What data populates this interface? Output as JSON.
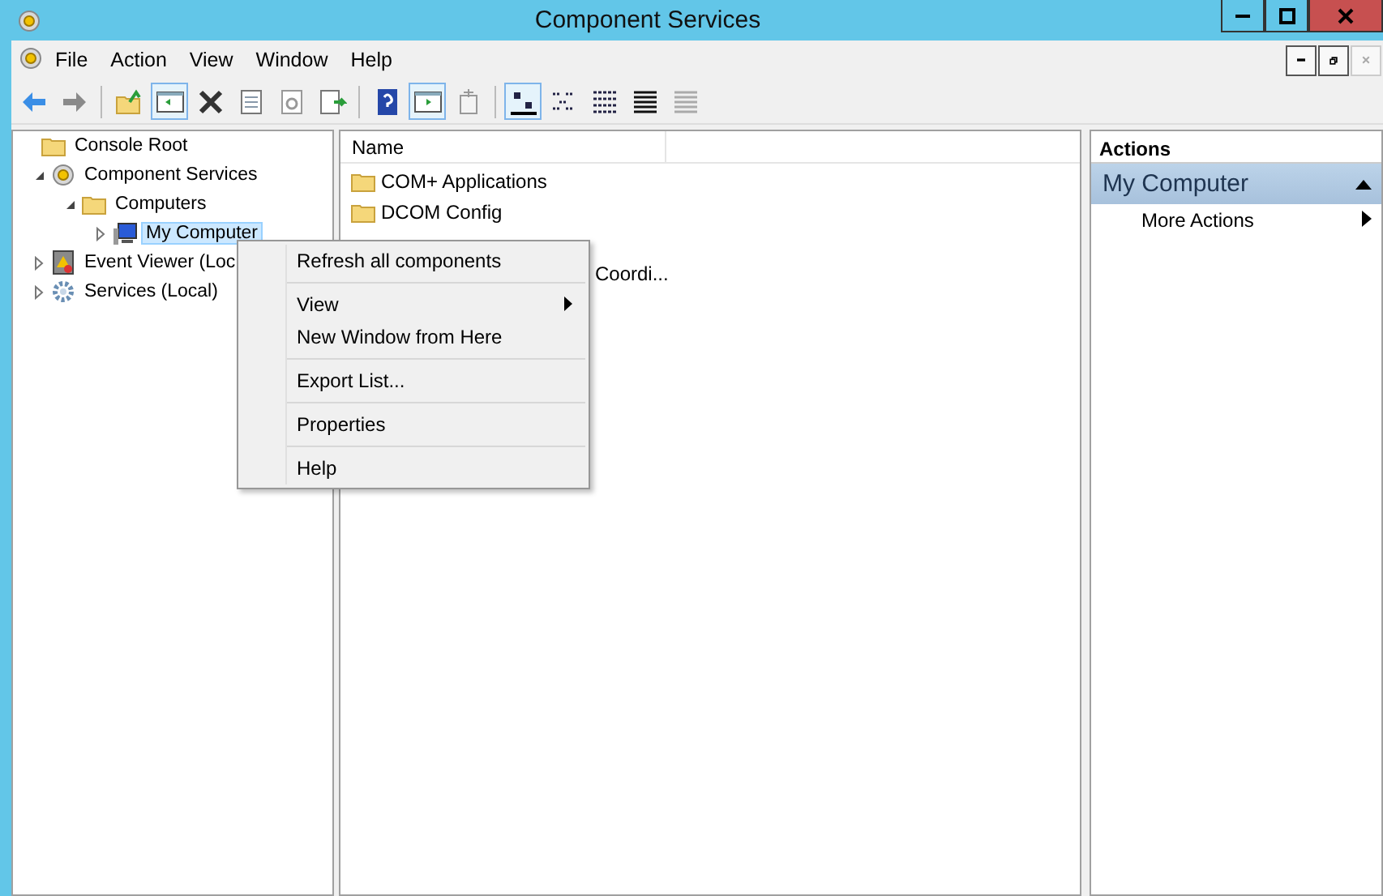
{
  "window": {
    "title": "Component Services"
  },
  "menu_bar": [
    "File",
    "Action",
    "View",
    "Window",
    "Help"
  ],
  "toolbar": [
    {
      "kind": "back",
      "pressed": false
    },
    {
      "kind": "forward",
      "pressed": false
    },
    {
      "kind": "sep"
    },
    {
      "kind": "up",
      "pressed": false
    },
    {
      "kind": "tree",
      "pressed": true
    },
    {
      "kind": "delete",
      "pressed": false
    },
    {
      "kind": "props",
      "pressed": false
    },
    {
      "kind": "refresh",
      "pressed": false
    },
    {
      "kind": "export",
      "pressed": false
    },
    {
      "kind": "sep"
    },
    {
      "kind": "help",
      "pressed": false
    },
    {
      "kind": "actionpane",
      "pressed": true
    },
    {
      "kind": "newwin",
      "pressed": false
    },
    {
      "kind": "sep"
    },
    {
      "kind": "large",
      "pressed": true
    },
    {
      "kind": "small",
      "pressed": false
    },
    {
      "kind": "list",
      "pressed": false
    },
    {
      "kind": "detail",
      "pressed": false
    },
    {
      "kind": "detail2",
      "pressed": false
    }
  ],
  "tree": [
    {
      "label": "Console Root",
      "kind": "folder",
      "children": [
        {
          "label": "Component Services",
          "kind": "comp",
          "expanded": true,
          "selected": false,
          "children": [
            {
              "label": "Computers",
              "kind": "folder",
              "expanded": true,
              "selected": false,
              "children": [
                {
                  "label": "My Computer",
                  "kind": "pc",
                  "expanded": false,
                  "selected": true
                }
              ]
            }
          ]
        },
        {
          "label": "Event Viewer (Loc",
          "kind": "event",
          "expanded": false,
          "selected": false
        },
        {
          "label": "Services (Local)",
          "kind": "gear",
          "expanded": false,
          "selected": false
        }
      ]
    }
  ],
  "list": {
    "columns": [
      "Name"
    ],
    "items": [
      {
        "label": "COM+ Applications",
        "kind": "full"
      },
      {
        "label": "DCOM Config",
        "kind": "full"
      },
      {
        "label": "Coordi...",
        "kind": "partial"
      }
    ]
  },
  "actions": {
    "title": "Actions",
    "section": "My Computer",
    "items": [
      {
        "label": "More Actions"
      }
    ]
  },
  "context_menu": {
    "groups": [
      [
        {
          "label": "Refresh all components",
          "submenu": false
        }
      ],
      [
        {
          "label": "View",
          "submenu": true
        },
        {
          "label": "New Window from Here",
          "submenu": false
        }
      ],
      [
        {
          "label": "Export List...",
          "submenu": false
        }
      ],
      [
        {
          "label": "Properties",
          "submenu": false
        }
      ],
      [
        {
          "label": "Help",
          "submenu": false
        }
      ]
    ]
  }
}
